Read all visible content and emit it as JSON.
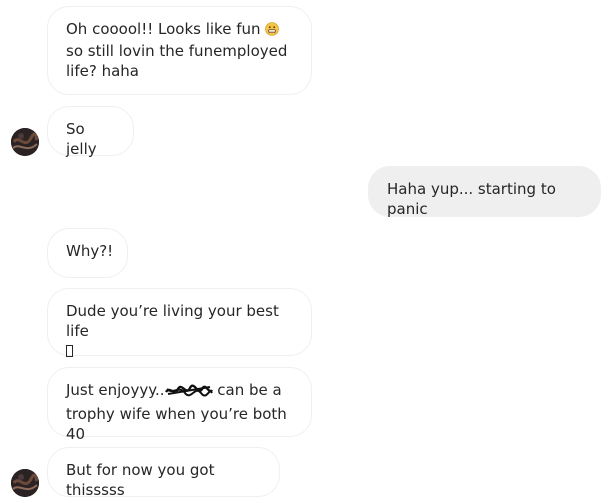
{
  "conversation": {
    "messages": [
      {
        "sender": "them",
        "text": "Oh cooool!! Looks like fun",
        "text_after": "so still lovin the funemployed life? haha",
        "emoji": "grinning-face-emoji"
      },
      {
        "sender": "them",
        "text": "So jelly"
      },
      {
        "sender": "me",
        "text": "Haha yup... starting to panic"
      },
      {
        "sender": "them",
        "text": "Why?!"
      },
      {
        "sender": "them",
        "text": "Dude you’re living your best life",
        "emoji": "unrendered-glyph-box"
      },
      {
        "sender": "them",
        "text": "Just enjoyyy..",
        "text_after": "can be a trophy wife when you’re both 40",
        "redaction": "scribbled-out-name"
      },
      {
        "sender": "them",
        "text": "But for now you got thisssss"
      }
    ]
  },
  "colors": {
    "incoming_bubble_bg": "#ffffff",
    "incoming_bubble_border": "#efefef",
    "outgoing_bubble_bg": "#efefef",
    "text": "#262626"
  }
}
